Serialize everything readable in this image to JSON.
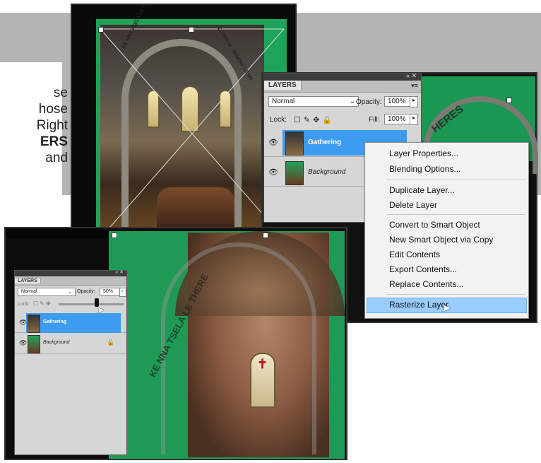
{
  "background_text": {
    "lines": [
      "se",
      "hose",
      " Right",
      "ERS",
      " and"
    ]
  },
  "photo_top": {
    "curved_text_left": "KE NNA TSELA LE THE",
    "curved_text_right": "TLOPA 02 · DIGERE LE MT"
  },
  "layers_panel_top": {
    "tab": "LAYERS",
    "blend_mode": "Normal",
    "opacity_label": "Opacity:",
    "opacity_value": "100%",
    "lock_label": "Lock:",
    "fill_label": "Fill:",
    "fill_value": "100%",
    "layers": [
      {
        "name": "Gathering",
        "selected": true
      },
      {
        "name": "Background",
        "selected": false
      }
    ]
  },
  "context_menu": {
    "items": [
      "Layer Properties...",
      "Blending Options...",
      "Duplicate Layer...",
      "Delete Layer",
      "Convert to Smart Object",
      "New Smart Object via Copy",
      "Edit Contents",
      "Export Contents...",
      "Replace Contents...",
      "Rasterize Layer"
    ],
    "highlighted": "Rasterize Layer"
  },
  "photo_right_text": "HERES",
  "layers_panel_bottom": {
    "tab": "LAYERS",
    "blend_mode": "Normal",
    "opacity_label": "Opacity:",
    "opacity_value": "50%",
    "lock_label": "Lock:",
    "layers": [
      {
        "name": "Gathering",
        "selected": true
      },
      {
        "name": "Background",
        "selected": false
      }
    ]
  },
  "photo_bottom": {
    "curved_text": "KE NNA TSELA LE THERE"
  },
  "colors": {
    "green": "#1ea35a",
    "selection": "#3d9bf0",
    "menu_highlight": "#99ccff"
  }
}
